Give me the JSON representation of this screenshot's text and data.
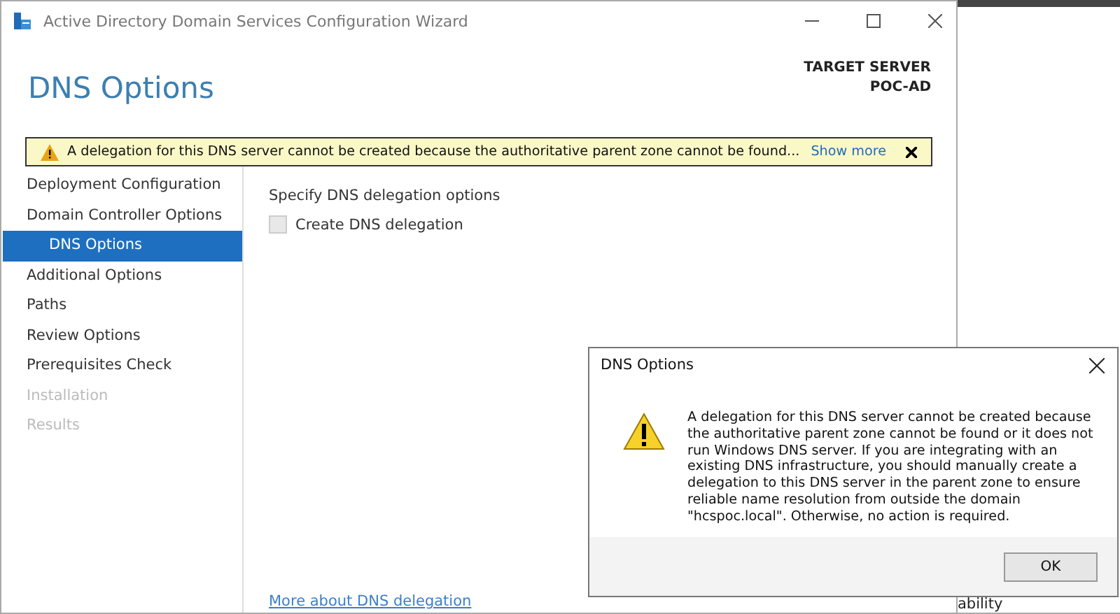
{
  "window": {
    "title": "Active Directory Domain Services Configuration Wizard"
  },
  "page_title": "DNS Options",
  "target_server": {
    "label": "TARGET SERVER",
    "name": "POC-AD"
  },
  "warning_bar": {
    "message": "A delegation for this DNS server cannot be created because the authoritative parent zone cannot be found...",
    "link": "Show more"
  },
  "sidebar": {
    "items": [
      {
        "label": "Deployment Configuration",
        "selected": false,
        "disabled": false,
        "sub": false
      },
      {
        "label": "Domain Controller Options",
        "selected": false,
        "disabled": false,
        "sub": false
      },
      {
        "label": "DNS Options",
        "selected": true,
        "disabled": false,
        "sub": true
      },
      {
        "label": "Additional Options",
        "selected": false,
        "disabled": false,
        "sub": false
      },
      {
        "label": "Paths",
        "selected": false,
        "disabled": false,
        "sub": false
      },
      {
        "label": "Review Options",
        "selected": false,
        "disabled": false,
        "sub": false
      },
      {
        "label": "Prerequisites Check",
        "selected": false,
        "disabled": false,
        "sub": false
      },
      {
        "label": "Installation",
        "selected": false,
        "disabled": true,
        "sub": false
      },
      {
        "label": "Results",
        "selected": false,
        "disabled": true,
        "sub": false
      }
    ]
  },
  "content": {
    "heading": "Specify DNS delegation options",
    "checkbox": {
      "label": "Create DNS delegation",
      "checked": false,
      "disabled": true
    },
    "link": "More about DNS delegation"
  },
  "background_text": "ability",
  "dialog": {
    "title": "DNS Options",
    "message": "A delegation for this DNS server cannot be created because the authoritative parent zone cannot be found or it does not run Windows DNS server. If you are integrating with an existing DNS infrastructure, you should manually create a delegation to this DNS server in the parent zone to ensure reliable name resolution from outside the domain \"hcspoc.local\". Otherwise, no action is required.",
    "button": "OK"
  }
}
